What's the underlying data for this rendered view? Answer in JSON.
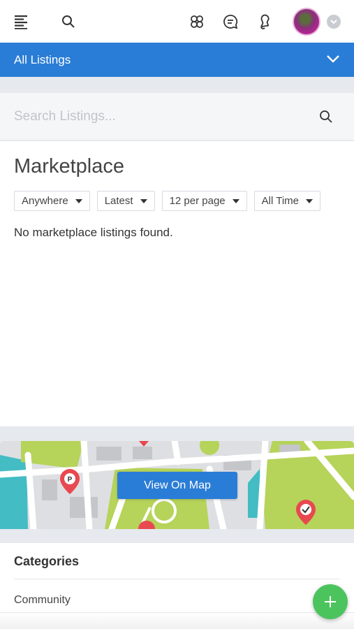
{
  "header": {
    "icons": [
      "menu-icon",
      "search-icon",
      "groups-icon",
      "chat-icon",
      "notification-bell-icon",
      "avatar",
      "chevron-down-icon"
    ]
  },
  "listing_bar": {
    "label": "All Listings",
    "icon": "chevron-down-icon"
  },
  "search": {
    "placeholder": "Search Listings...",
    "icon": "search-icon"
  },
  "main": {
    "title": "Marketplace",
    "filters": [
      {
        "label": "Anywhere"
      },
      {
        "label": "Latest"
      },
      {
        "label": "12 per page"
      },
      {
        "label": "All Time"
      }
    ],
    "empty_message": "No marketplace listings found."
  },
  "map": {
    "button_label": "View On Map"
  },
  "categories": {
    "heading": "Categories",
    "items": [
      "Community"
    ]
  },
  "fab": {
    "icon": "plus-icon"
  },
  "colors": {
    "primary": "#2a7dd6",
    "fab": "#4cc45e",
    "pin": "#e8484f",
    "map_green": "#b6d35a"
  }
}
